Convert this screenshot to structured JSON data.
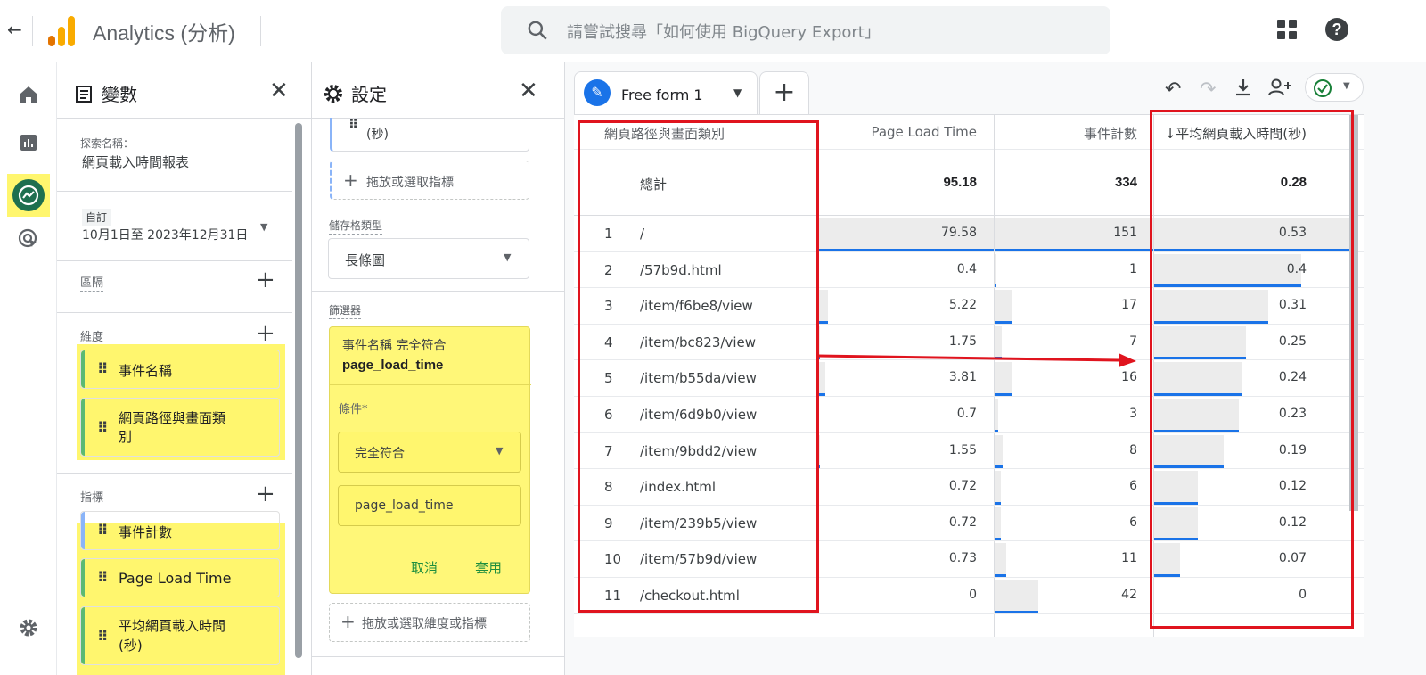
{
  "header": {
    "app_title": "Analytics (分析)",
    "search_placeholder": "請嘗試搜尋「如何使用 BigQuery Export」",
    "logo_colors": [
      "#f9ab00",
      "#e37400"
    ]
  },
  "rail": {
    "items": [
      "home-icon",
      "reports-icon",
      "explore-icon",
      "advertising-icon"
    ],
    "settings": "gear-icon"
  },
  "variables": {
    "title": "變數",
    "exploration_label": "探索名稱：",
    "exploration_name": "網頁載入時間報表",
    "date_tag": "自訂",
    "date_range": "10月1日至 2023年12月31日",
    "segments_label": "區隔",
    "dimensions_label": "維度",
    "dimensions": [
      "事件名稱",
      "網頁路徑與畫面類\n別"
    ],
    "metrics_label": "指標",
    "metrics": [
      "事件計數",
      "Page Load Time",
      "平均網頁載入時間\n(秒)"
    ]
  },
  "settings": {
    "title": "設定",
    "top_item": "(秒)",
    "drop_metric": "拖放或選取指標",
    "cell_type_label": "儲存格類型",
    "cell_type": "長條圖",
    "filters_label": "篩選器",
    "filter_title": "事件名稱 完全符合",
    "filter_value_bold": "page_load_time",
    "condition_label": "條件*",
    "condition": "完全符合",
    "condition_value": "page_load_time",
    "cancel": "取消",
    "apply": "套用",
    "drop_dim_metric": "拖放或選取維度或指標"
  },
  "canvas": {
    "tab_name": "Free form 1",
    "ok_color": "#188038",
    "columns": [
      "網頁路徑與畫面類別",
      "Page Load Time",
      "事件計數",
      "↓平均網頁載入時間(秒)"
    ],
    "total_label": "總計",
    "totals": [
      "95.18",
      "334",
      "0.28"
    ],
    "rows": [
      {
        "n": "1",
        "path": "/",
        "plt": "79.58",
        "ev": "151",
        "avg": "0.53",
        "f_plt": 1.0,
        "f_ev": 1.0,
        "f_avg": 1.0
      },
      {
        "n": "2",
        "path": "/57b9d.html",
        "plt": "0.4",
        "ev": "1",
        "avg": "0.4",
        "f_plt": 0.005,
        "f_ev": 0.007,
        "f_avg": 0.755
      },
      {
        "n": "3",
        "path": "/item/f6be8/view",
        "plt": "5.22",
        "ev": "17",
        "avg": "0.31",
        "f_plt": 0.066,
        "f_ev": 0.113,
        "f_avg": 0.585
      },
      {
        "n": "4",
        "path": "/item/bc823/view",
        "plt": "1.75",
        "ev": "7",
        "avg": "0.25",
        "f_plt": 0.022,
        "f_ev": 0.046,
        "f_avg": 0.472
      },
      {
        "n": "5",
        "path": "/item/b55da/view",
        "plt": "3.81",
        "ev": "16",
        "avg": "0.24",
        "f_plt": 0.048,
        "f_ev": 0.106,
        "f_avg": 0.453
      },
      {
        "n": "6",
        "path": "/item/6d9b0/view",
        "plt": "0.7",
        "ev": "3",
        "avg": "0.23",
        "f_plt": 0.009,
        "f_ev": 0.02,
        "f_avg": 0.434
      },
      {
        "n": "7",
        "path": "/item/9bdd2/view",
        "plt": "1.55",
        "ev": "8",
        "avg": "0.19",
        "f_plt": 0.019,
        "f_ev": 0.053,
        "f_avg": 0.358
      },
      {
        "n": "8",
        "path": "/index.html",
        "plt": "0.72",
        "ev": "6",
        "avg": "0.12",
        "f_plt": 0.009,
        "f_ev": 0.04,
        "f_avg": 0.226
      },
      {
        "n": "9",
        "path": "/item/239b5/view",
        "plt": "0.72",
        "ev": "6",
        "avg": "0.12",
        "f_plt": 0.009,
        "f_ev": 0.04,
        "f_avg": 0.226
      },
      {
        "n": "10",
        "path": "/item/57b9d/view",
        "plt": "0.73",
        "ev": "11",
        "avg": "0.07",
        "f_plt": 0.009,
        "f_ev": 0.073,
        "f_avg": 0.132
      },
      {
        "n": "11",
        "path": "/checkout.html",
        "plt": "0",
        "ev": "42",
        "avg": "0",
        "f_plt": 0.0,
        "f_ev": 0.278,
        "f_avg": 0.0
      }
    ]
  }
}
